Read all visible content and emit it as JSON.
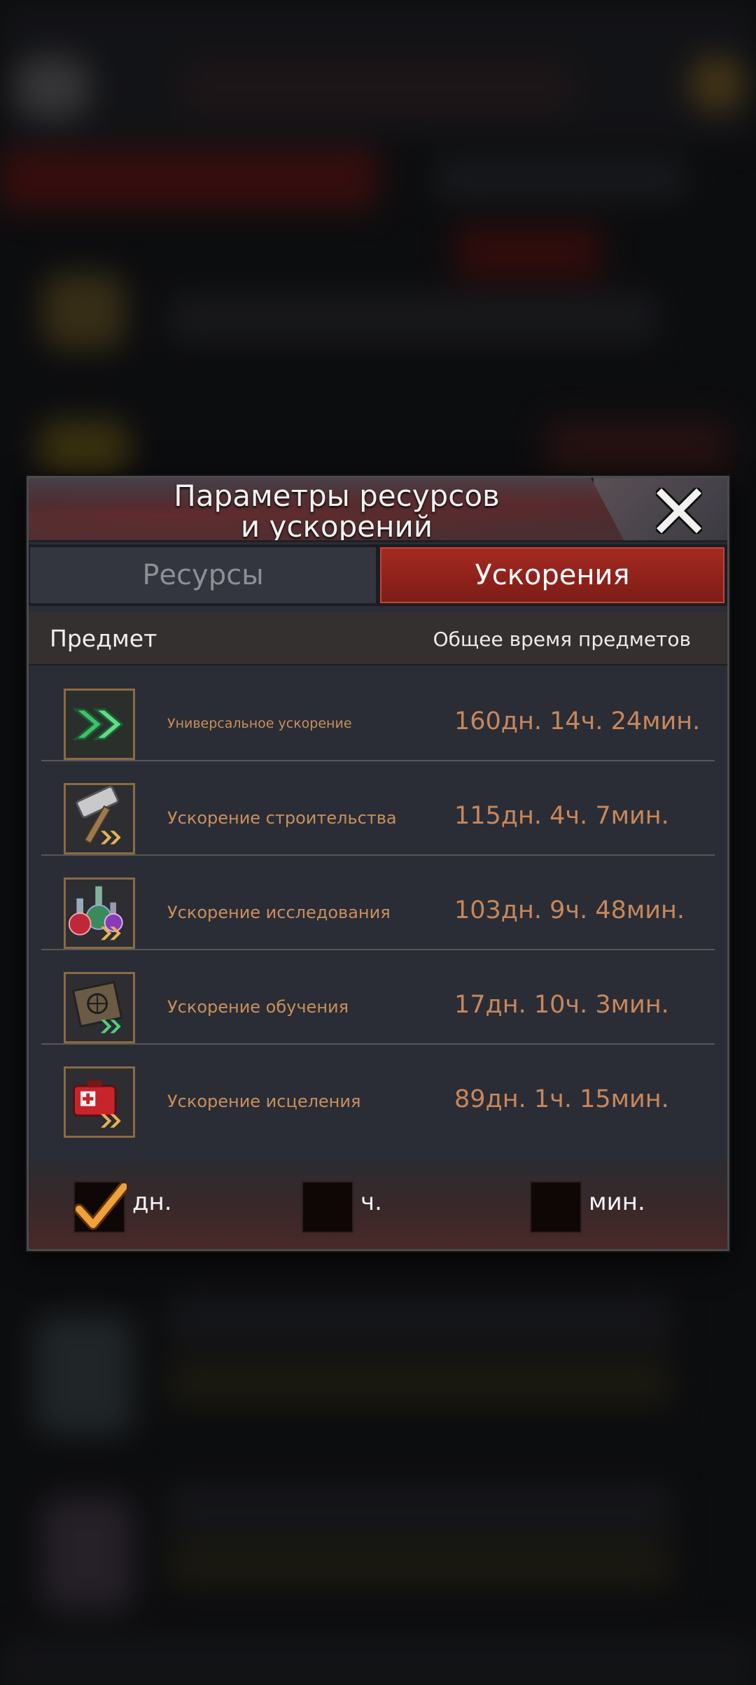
{
  "dialog": {
    "title": "Параметры ресурсов и ускорений",
    "tabs": [
      {
        "label": "Ресурсы",
        "active": false
      },
      {
        "label": "Ускорения",
        "active": true
      }
    ],
    "columns": {
      "item": "Предмет",
      "total_time": "Общее время предметов"
    },
    "items": [
      {
        "icon": "universal-speedup-icon",
        "name": "Универсальное ускорение",
        "time": "160дн. 14ч. 24мин."
      },
      {
        "icon": "construction-speedup-icon",
        "name": "Ускорение строительства",
        "time": "115дн. 4ч. 7мин."
      },
      {
        "icon": "research-speedup-icon",
        "name": "Ускорение исследования",
        "time": "103дн. 9ч. 48мин."
      },
      {
        "icon": "training-speedup-icon",
        "name": "Ускорение обучения",
        "time": "17дн. 10ч. 3мин."
      },
      {
        "icon": "healing-speedup-icon",
        "name": "Ускорение исцеления",
        "time": "89дн. 1ч. 15мин."
      }
    ],
    "units": [
      {
        "label": "дн.",
        "checked": true
      },
      {
        "label": "ч.",
        "checked": false
      },
      {
        "label": "мин.",
        "checked": false
      }
    ]
  },
  "colors": {
    "accent_red": "#a42a22",
    "value_orange": "#c8875a",
    "check_orange": "#f0a13a"
  }
}
